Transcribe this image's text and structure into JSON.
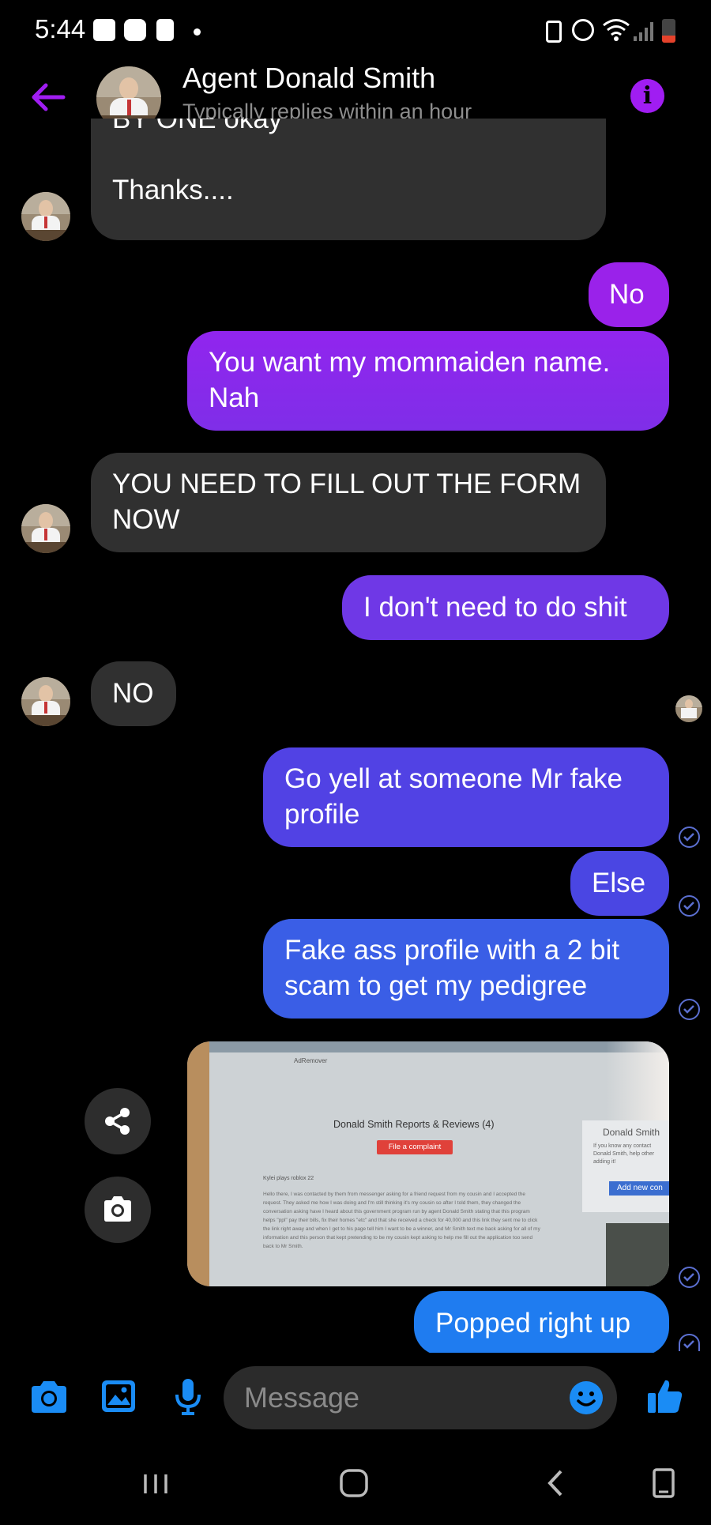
{
  "status_bar": {
    "time": "5:44"
  },
  "header": {
    "contact_name": "Agent Donald Smith",
    "subtitle": "Typically replies within an hour"
  },
  "messages": [
    {
      "from": "them",
      "text": "BY ONE okay\n\nThanks....",
      "visible_text": "Thanks...."
    },
    {
      "from": "me",
      "text": "No"
    },
    {
      "from": "me",
      "text": "You want my mommaiden name. Nah"
    },
    {
      "from": "them",
      "text": "YOU NEED TO FILL OUT THE FORM NOW"
    },
    {
      "from": "me",
      "text": "I don't need to do shit"
    },
    {
      "from": "them",
      "text": "NO"
    },
    {
      "from": "me",
      "text": "Go yell at someone Mr fake profile"
    },
    {
      "from": "me",
      "text": "Else"
    },
    {
      "from": "me",
      "text": "Fake ass profile with a 2 bit scam to get my pedigree"
    },
    {
      "from": "me",
      "type": "photo"
    },
    {
      "from": "me",
      "text": "Popped right up"
    }
  ],
  "photo_content": {
    "top_label": "AdRemover",
    "title": "Donald Smith Reports & Reviews (4)",
    "button": "File a complaint",
    "sidebar_title": "Donald Smith",
    "sidebar_text": "If you know any contact Donald Smith, help other adding it!",
    "sidebar_button": "Add new con",
    "review_author": "Kylei plays roblox 22",
    "review_text": "Hello there, I was contacted by them from messenger asking for a friend request from my cousin and I accepted the request. They asked me how I was doing and I'm still thinking it's my cousin so after I told them, they changed the conversation asking have I heard about this government program run by agent Donald Smith stating that this program helps \"ppl\" pay their bills, fix their homes \"etc\" and that she received a check for 40,000 and this link they sent me to click the link right away and when I get to his page tell him I want to be a winner, and Mr Smith text me back asking for all of my information and this person that kept pretending to be my cousin kept asking to help me fill out the application too send back to Mr Smith."
  },
  "composer": {
    "placeholder": "Message"
  },
  "colors": {
    "accent_purple": "#a01df2",
    "bubble_incoming": "#303030",
    "blue_icon": "#1a8cf5"
  }
}
